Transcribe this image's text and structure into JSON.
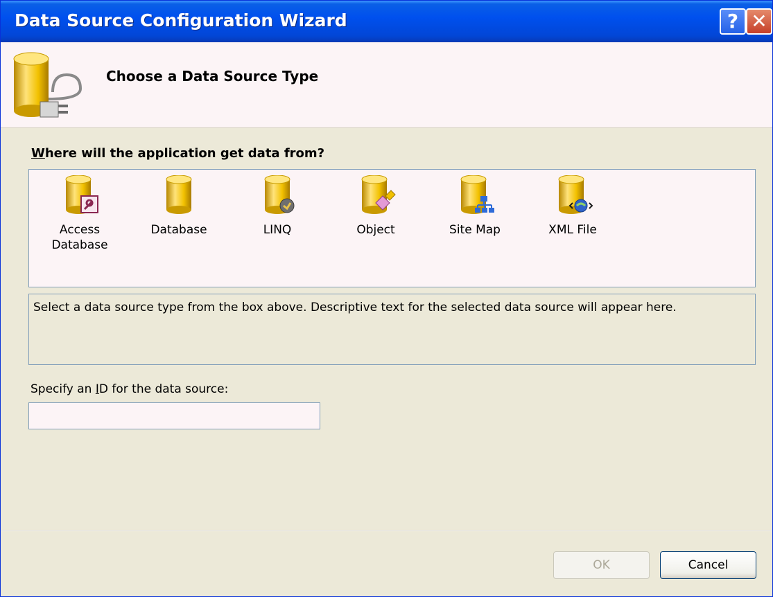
{
  "window": {
    "title": "Data Source Configuration Wizard",
    "help_glyph": "?",
    "close_glyph": "✕"
  },
  "header": {
    "heading": "Choose a Data Source Type",
    "icon": "database-plug-icon"
  },
  "question": {
    "mnemonic": "W",
    "rest": "here will the application get data from?"
  },
  "sources": [
    {
      "label_line1": "Access",
      "label_line2": "Database",
      "icon": "access-database-icon"
    },
    {
      "label_line1": "Database",
      "label_line2": "",
      "icon": "database-icon"
    },
    {
      "label_line1": "LINQ",
      "label_line2": "",
      "icon": "linq-icon"
    },
    {
      "label_line1": "Object",
      "label_line2": "",
      "icon": "object-icon"
    },
    {
      "label_line1": "Site Map",
      "label_line2": "",
      "icon": "site-map-icon"
    },
    {
      "label_line1": "XML File",
      "label_line2": "",
      "icon": "xml-file-icon"
    }
  ],
  "description": "Select a data source type from the box above. Descriptive text for the selected data source will appear here.",
  "id_field": {
    "label_pre": "Specify an ",
    "label_mnemonic": "I",
    "label_post": "D for the data source:",
    "value": ""
  },
  "buttons": {
    "ok": "OK",
    "cancel": "Cancel"
  },
  "colors": {
    "titlebar": "#0050ee",
    "cylinder": "#f2c100",
    "panel": "#fcf4f6",
    "dialog": "#ece9d8"
  }
}
